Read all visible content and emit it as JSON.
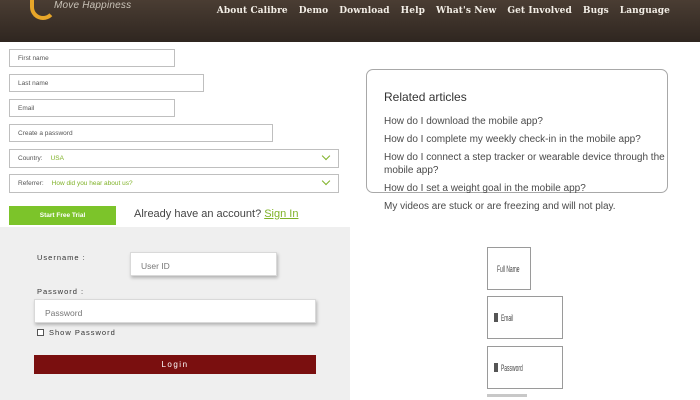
{
  "header": {
    "logo_tagline": "Move Happiness",
    "nav": [
      "About Calibre",
      "Demo",
      "Download",
      "Help",
      "What's New",
      "Get Involved",
      "Bugs",
      "Language"
    ]
  },
  "signup": {
    "first_name_placeholder": "First name",
    "last_name_placeholder": "Last name",
    "email_placeholder": "Email",
    "password_placeholder": "Create a password",
    "country_label": "Country:",
    "country_value": "USA",
    "referrer_label": "Referrer:",
    "referrer_value": "How did you hear about us?",
    "trial_button": "Start Free Trial",
    "already_text": "Already have an account?",
    "signin_link": "Sign In"
  },
  "related": {
    "title": "Related articles",
    "links": [
      "How do I download the mobile app?",
      "How do I complete my weekly check-in in the mobile app?",
      "How do I connect a step tracker or wearable device through the mobile app?",
      "How do I set a weight goal in the mobile app?",
      "My videos are stuck or are freezing and will not play."
    ]
  },
  "login": {
    "username_label": "Username :",
    "username_placeholder": "User ID",
    "password_label": "Password :",
    "password_placeholder": "Password",
    "show_password": "Show Password",
    "login_button": "Login"
  },
  "mini_form": {
    "full_name": "Full Name",
    "email": "Email",
    "password": "Password"
  },
  "colors": {
    "accent_green": "#7cc42a",
    "login_red": "#7a0f0f",
    "nav_bg": "#3a3029"
  }
}
